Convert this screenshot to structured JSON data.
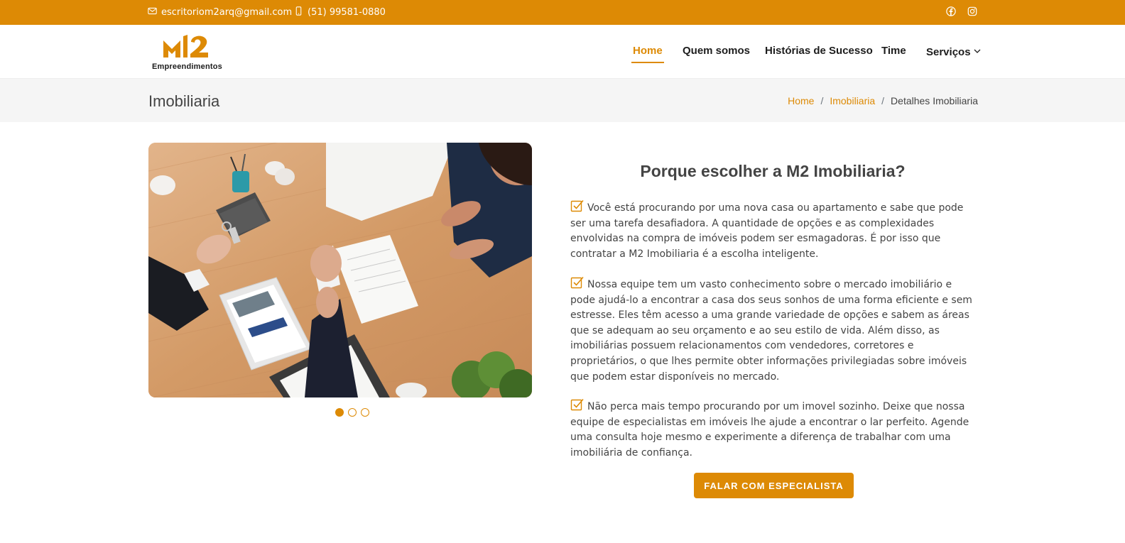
{
  "topbar": {
    "email": "escritoriom2arq@gmail.com",
    "phone": "(51) 99581-0880",
    "icons": [
      "envelope-icon",
      "phone-icon",
      "facebook-icon",
      "instagram-icon"
    ]
  },
  "brand": {
    "logo_mark": "M2",
    "logo_sub": "Empreendimentos",
    "accent_color": "#dd8a05"
  },
  "nav": {
    "items": [
      {
        "label": "Home",
        "active": true
      },
      {
        "label": "Quem somos",
        "active": false
      },
      {
        "label": "Histórias de Sucesso",
        "active": false
      },
      {
        "label": "Time",
        "active": false
      },
      {
        "label": "Serviços",
        "active": false
      }
    ]
  },
  "breadcrumb": {
    "title": "Imobiliaria",
    "items": [
      "Home",
      "Imobiliaria",
      "Detalhes Imobiliaria"
    ],
    "separator": "/"
  },
  "carousel": {
    "slides": 3,
    "active_slide": 1,
    "image_alt": "Aperto de mãos em mesa de madeira com chaves e documentos"
  },
  "content": {
    "heading": "Porque escolher a M2 Imobiliaria?",
    "paragraphs": [
      "Você está procurando por uma nova casa ou apartamento e sabe que pode ser uma tarefa desafiadora. A quantidade de opções e as complexidades envolvidas na compra de imóveis podem ser esmagadoras. É por isso que contratar a M2 Imobiliaria é a escolha inteligente.",
      "Nossa equipe tem um vasto conhecimento sobre o mercado imobiliário e pode ajudá-lo a encontrar a casa dos seus sonhos de uma forma eficiente e sem estresse. Eles têm acesso a uma grande variedade de opções e sabem as áreas que se adequam ao seu orçamento e ao seu estilo de vida. Além disso, as imobiliárias possuem relacionamentos com vendedores, corretores e proprietários, o que lhes permite obter informações privilegiadas sobre imóveis que podem estar disponíveis no mercado.",
      "Não perca mais tempo procurando por um imovel sozinho. Deixe que nossa equipe de especialistas em imóveis lhe ajude a encontrar o lar perfeito. Agende uma consulta hoje mesmo e experimente a diferença de trabalhar com uma imobiliária de confiança."
    ],
    "cta_label": "FALAR COM ESPECIALISTA"
  }
}
